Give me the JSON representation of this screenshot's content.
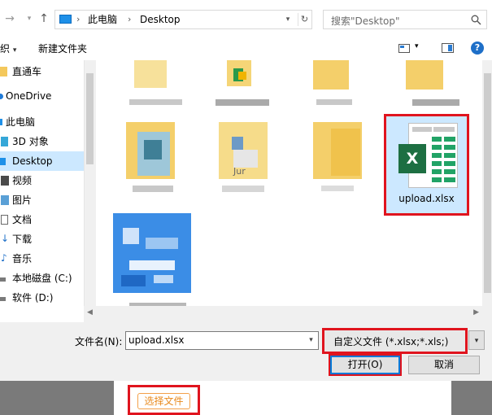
{
  "address": {
    "path": [
      "此电脑",
      "Desktop"
    ],
    "search_placeholder": "搜索\"Desktop\""
  },
  "toolbar": {
    "organize_label": "织",
    "new_folder_label": "新建文件夹"
  },
  "sidebar": {
    "items": [
      {
        "label": "直通车",
        "icon": "folder-icon"
      },
      {
        "label": "OneDrive",
        "icon": "cloud-icon"
      },
      {
        "label": "此电脑",
        "icon": "computer-icon"
      },
      {
        "label": "3D 对象",
        "icon": "cube-icon"
      },
      {
        "label": "Desktop",
        "icon": "desktop-icon",
        "selected": true
      },
      {
        "label": "视频",
        "icon": "video-icon"
      },
      {
        "label": "图片",
        "icon": "picture-icon"
      },
      {
        "label": "文档",
        "icon": "document-icon"
      },
      {
        "label": "下载",
        "icon": "download-icon"
      },
      {
        "label": "音乐",
        "icon": "music-icon"
      },
      {
        "label": "本地磁盘 (C:)",
        "icon": "drive-icon"
      },
      {
        "label": "软件 (D:)",
        "icon": "drive-icon"
      }
    ]
  },
  "files": {
    "selected_name": "upload.xlsx",
    "partial_label": "Jur"
  },
  "bottom": {
    "filename_label": "文件名(N):",
    "filename_value": "upload.xlsx",
    "filetype_value": "自定义文件 (*.xlsx;*.xls;)",
    "open_label": "打开(O)",
    "cancel_label": "取消"
  },
  "page": {
    "choose_file_label": "选择文件"
  }
}
